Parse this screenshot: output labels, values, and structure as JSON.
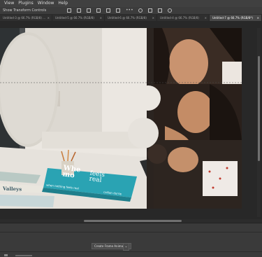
{
  "menubar": {
    "items": [
      "View",
      "Plugins",
      "Window",
      "Help"
    ]
  },
  "options_bar": {
    "label": "Show Transform Controls"
  },
  "tabs": [
    {
      "label": "Untitled-3 @ 66.7% (RGB/8) ...",
      "active": false
    },
    {
      "label": "Untitled-5 @ 66.7% (RGB/8)",
      "active": false
    },
    {
      "label": "Untitled-6 @ 66.7% (RGB/8)",
      "active": false
    },
    {
      "label": "Untitled-4 @ 66.7% (RGB/8)",
      "active": false
    },
    {
      "label": "Untitled-7 @ 66.7% (RGB/8*)",
      "active": true
    }
  ],
  "tab_close": "×",
  "book": {
    "title_line1": "Whe",
    "title_line2": "mo",
    "title_line3": "feels",
    "title_line4": "real",
    "subtitle": "when nothing feels real",
    "author": "cailian durrie",
    "spine_author": "cailian durrie",
    "second_book": "Valleys"
  },
  "timeline": {
    "create_button": "Create Frame Animation",
    "dropdown_glyph": "⌄"
  },
  "colors": {
    "ui_dark": "#282828",
    "book_teal": "#2aa3b3",
    "wall": "#ece8e2"
  }
}
